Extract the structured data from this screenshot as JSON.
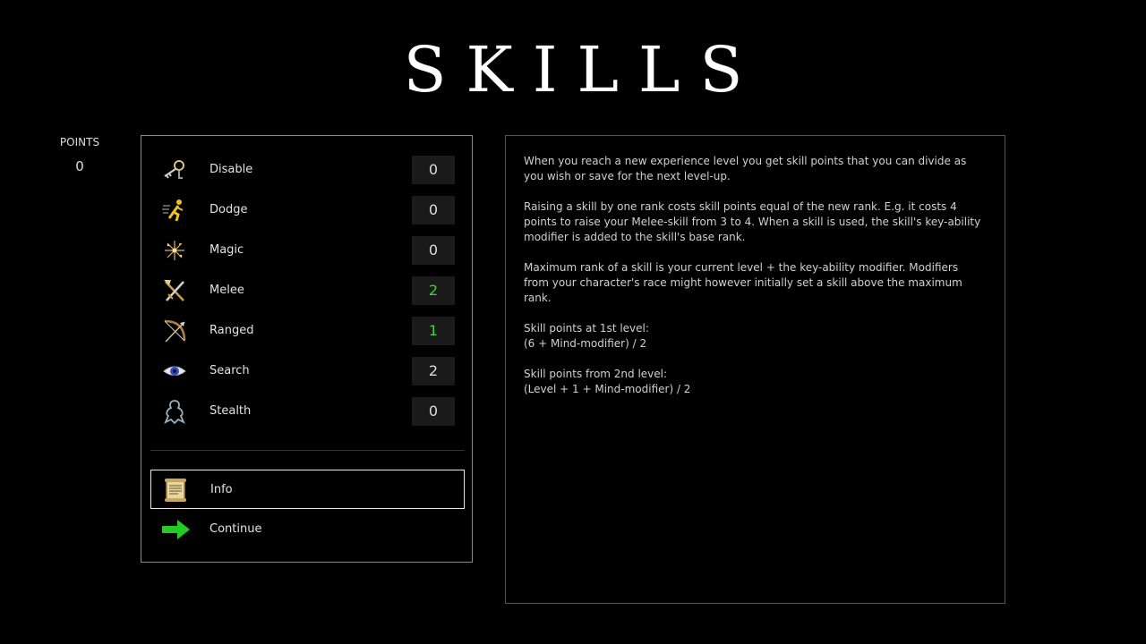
{
  "title": "SKILLS",
  "points": {
    "label": "POINTS",
    "value": "0"
  },
  "skills": [
    {
      "name": "Disable",
      "value": "0",
      "icon": "lockpick-key-icon"
    },
    {
      "name": "Dodge",
      "value": "0",
      "icon": "running-figure-icon"
    },
    {
      "name": "Magic",
      "value": "0",
      "icon": "sparkles-icon"
    },
    {
      "name": "Melee",
      "value": "2",
      "icon": "crossed-axe-sword-icon"
    },
    {
      "name": "Ranged",
      "value": "1",
      "icon": "bow-and-arrow-icon"
    },
    {
      "name": "Search",
      "value": "2",
      "icon": "eye-icon"
    },
    {
      "name": "Stealth",
      "value": "0",
      "icon": "ghost-silhouette-icon"
    }
  ],
  "actions": [
    {
      "name": "Info",
      "icon": "scroll-icon"
    },
    {
      "name": "Continue",
      "icon": "green-arrow-right-icon"
    }
  ],
  "colors": {
    "raised_value": "#3fcf3f",
    "continue_arrow": "#22cc22"
  },
  "info": {
    "paragraphs": [
      "When you reach a new experience level you get skill points that you can divide as you wish or save for the next level-up.",
      "Raising a skill by one rank costs skill points equal of the new rank. E.g. it costs 4 points to raise your Melee-skill from 3 to 4. When a skill is used, the skill's key-ability modifier is added to the skill's base rank.",
      "Maximum rank of a skill is your current level + the key-ability modifier. Modifiers from your character's race might however initially set a skill above the maximum rank.",
      "Skill points at 1st level:\n(6 + Mind-modifier) / 2",
      "Skill points from 2nd level:\n(Level + 1 + Mind-modifier) / 2"
    ]
  }
}
